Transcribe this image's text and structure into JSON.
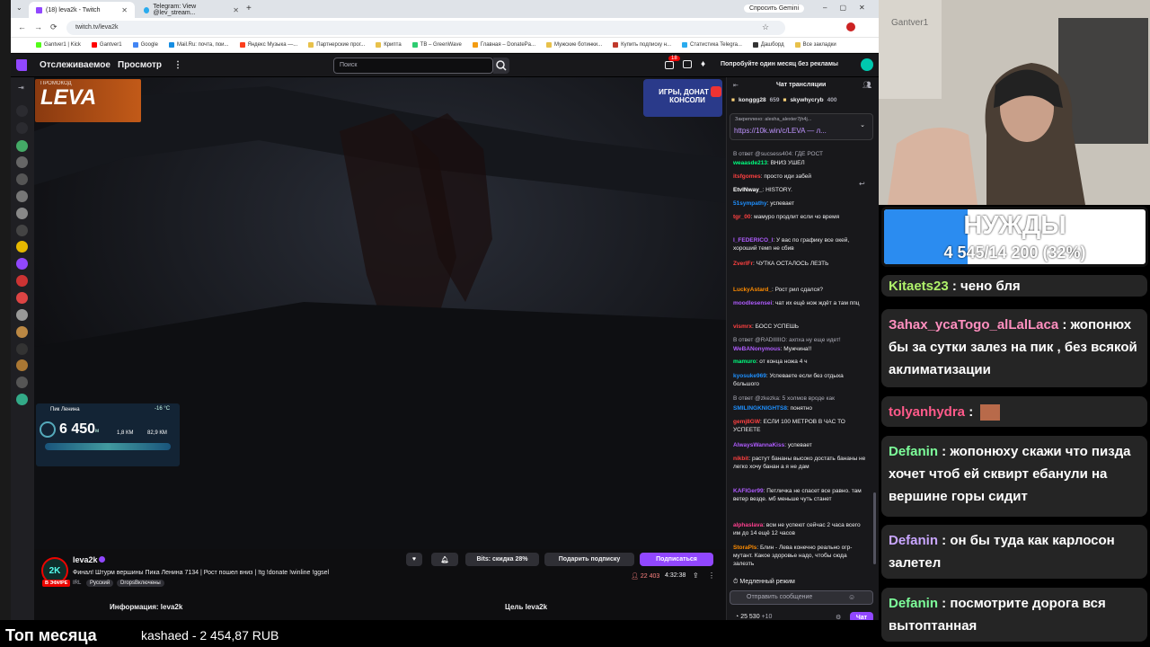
{
  "browser": {
    "tabs": [
      {
        "label": "(18) leva2k - Twitch"
      },
      {
        "label": "Telegram: View @lev_stream..."
      }
    ],
    "new_tab": "+",
    "gemini_label": "Спросить Gemini",
    "url": "twitch.tv/leva2k",
    "bookmarks": [
      "Gantver1 | Kick",
      "Gantver1",
      "Google",
      "Mail.Ru: почта, пои...",
      "Яндекс Музыка —...",
      "Партнерские прог...",
      "Крипта",
      "TB – GreenWave",
      "Главная – DonatePa...",
      "Мужские ботинки...",
      "Купить подписку н...",
      "Статистика Telegra...",
      "Дашборд",
      "Все закладки"
    ]
  },
  "twitch": {
    "nav": {
      "following": "Отслеживаемое",
      "browse": "Просмотр",
      "more": "⋮"
    },
    "search_placeholder": "Поиск",
    "notif_badge": "18",
    "prime_promo": "Попробуйте один месяц без рекламы",
    "player": {
      "promo_label": "ПРОМОКОД",
      "promo_code": "LEVA",
      "ad_text": "ИГРЫ, ДОНАТ И КОНСОЛИ",
      "stats": {
        "peak": "Пик Ленина",
        "altitude": "6 450",
        "unit": "м",
        "temp": "-16 °C",
        "speed": "82,9 КМ",
        "dist": "1,8 КМ"
      }
    },
    "stream": {
      "channel": "leva2k",
      "title": "Финал! Штурм вершины Пика Ленина 7134 | Рост пошел вниз | !tg !donate !winline !ggsel",
      "live_badge": "В ЭФИРЕ",
      "tags": [
        "IRL",
        "Русский",
        "DropsВключены"
      ],
      "viewers": "22 403",
      "uptime": "4:32:38",
      "bits_label": "Bits: скидка 28%",
      "gift_label": "Подарить подписку",
      "subscribe_label": "Подписаться",
      "about_label": "Информация: leva2k",
      "goal_label": "Цель leva2k"
    },
    "chat": {
      "title": "Чат трансляции",
      "top_gifters": [
        {
          "name": "konggg28",
          "count": "659"
        },
        {
          "name": "skywhycryb",
          "count": "400"
        }
      ],
      "pinned_by": "Закреплено: alesha_alexter7jh4j...",
      "pinned_link": "https://10k.win/c/LEVA — л...",
      "messages": [
        {
          "user": "",
          "text": "В ответ @sucsess404: ГДЕ РОСТ",
          "color": "#adadb8"
        },
        {
          "user": "weaasde213",
          "text": ": ВНИЗ УШЕЛ",
          "color": "#00ff7f"
        },
        {
          "user": "itsfgomes",
          "text": ": просто иди забей",
          "color": "#ff4040"
        },
        {
          "user": "EtvINway_",
          "text": ": HISTORY.",
          "color": "#ffffff"
        },
        {
          "user": "51sympathy",
          "text": ": успевает",
          "color": "#1e90ff"
        },
        {
          "user": "tgr_00",
          "text": ": мамуро продлит если чо время",
          "color": "#ff4040"
        },
        {
          "user": "l_FEDERICO_l",
          "text": ": У вас по графику все окей, хороший темп не сбив",
          "color": "#b05cff"
        },
        {
          "user": "ZverlFr",
          "text": ": ЧУТКА ОСТАЛОСЬ ЛЕЗТЬ",
          "color": "#ff4040"
        },
        {
          "user": "LuckyAstard_",
          "text": ": Рост рил сдался?",
          "color": "#ff8c00"
        },
        {
          "user": "moodlesensei",
          "text": ": чат их ещё нож ждёт а там ппц",
          "color": "#b05cff"
        },
        {
          "user": "vismrx",
          "text": ": БОСС УСПЕШЬ",
          "color": "#ff4040"
        },
        {
          "user": "",
          "text": "В ответ @RADIIIIIO: ахпха ну еще идет!",
          "color": "#adadb8"
        },
        {
          "user": "WeBANonymous",
          "text": ": Мужчина!!",
          "color": "#b05cff"
        },
        {
          "user": "mamuro",
          "text": ": от конца ножа 4 ч",
          "color": "#00ff7f"
        },
        {
          "user": "kyosuke969",
          "text": ": Успеваете если без отдыха большого",
          "color": "#1e90ff"
        },
        {
          "user": "",
          "text": "В ответ @zkezka: 5 холмов вроде как",
          "color": "#adadb8"
        },
        {
          "user": "SMILINGKNIGHTS8",
          "text": ": понятно",
          "color": "#1e90ff"
        },
        {
          "user": "gemj8GW",
          "text": ": ЕСЛИ 100 МЕТРОВ В ЧАС ТО УСПЕЕТЕ",
          "color": "#ff4040"
        },
        {
          "user": "AlwaysWannaKiss",
          "text": ": успевает",
          "color": "#b05cff"
        },
        {
          "user": "nikbit",
          "text": ": растут бананы высоко достать бананы не легко хочу банан а я не дам",
          "color": "#ff4040"
        },
        {
          "user": "KAFIGer99",
          "text": ": Петличка не спасет все равно. там ветер везде. мб меньше чуть станет",
          "color": "#b05cff"
        },
        {
          "user": "alphaslava",
          "text": ": всм не успеют сейчас 2 часа всего им до 14 ещё 12 часов",
          "color": "#ff4090"
        },
        {
          "user": "StoraPls",
          "text": ": Блин - Лева конечно реально огр-мутант. Какое здоровье надо, чтобы сюда залезть",
          "color": "#ff8c00"
        }
      ],
      "slow_mode": "Медленный режим",
      "input_placeholder": "Отправить сообщение",
      "points": "25 530",
      "points_plus": "+10",
      "send_label": "Чат"
    }
  },
  "overlay": {
    "cam_label": "Gantver1",
    "goal_title": "НУЖДЫ",
    "goal_progress": "4 545/14 200 (32%)",
    "goal_fraction": 0.32,
    "donor_chat": [
      {
        "user": "Kitaets23",
        "text": " : чено бля"
      },
      {
        "user": "Зahax_ycaTogo_alLalLaca",
        "text": " : жопонюх бы за сутки залез на пик , без всякой аклиматизации"
      },
      {
        "user": "tolyanhydra",
        "text": " : "
      },
      {
        "user": "Defanin",
        "text": " : жопонюху скажи что пизда хочет чтоб ей сквирт ебанули на вершине горы сидит"
      },
      {
        "user": "Defanin",
        "text": " : он бы туда как карлосон залетел"
      },
      {
        "user": "Defanin",
        "text": " : посмотрите дорога вся вытоптанная"
      }
    ],
    "top_month_label": "Топ месяца",
    "top_month_entry": "kashaed - 2 454,87 RUB"
  },
  "colors": {
    "twitch_purple": "#9147ff",
    "twitch_bg": "#0e0e10",
    "goal_blue": "#2b8cf0",
    "live_red": "#eb0400"
  }
}
